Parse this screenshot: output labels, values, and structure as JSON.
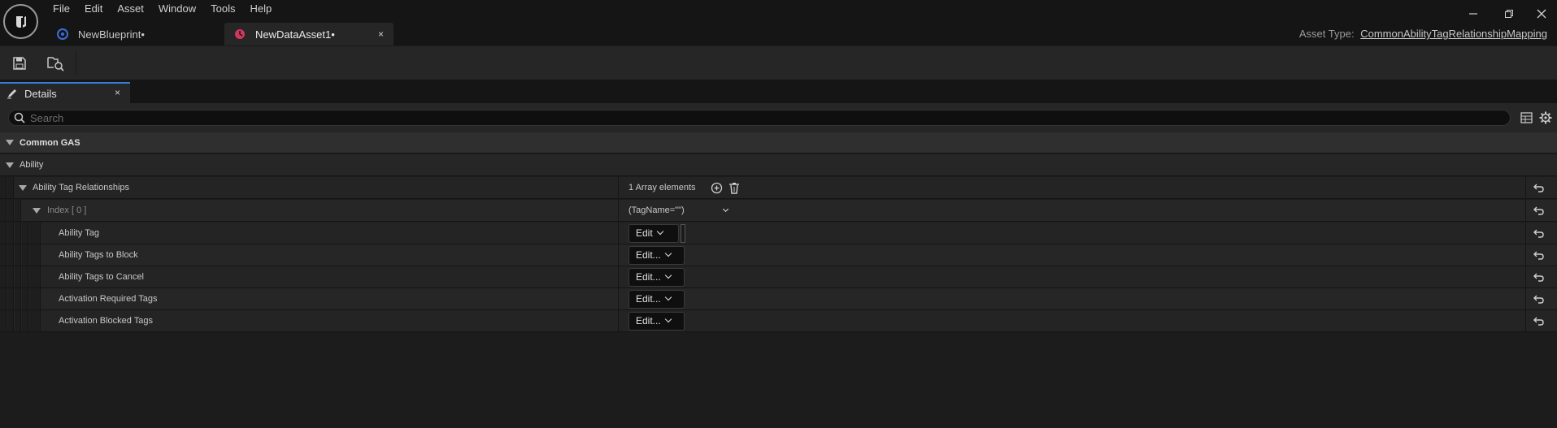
{
  "menu": [
    "File",
    "Edit",
    "Asset",
    "Window",
    "Tools",
    "Help"
  ],
  "tabs": [
    {
      "label": "NewBlueprint•",
      "icon": "blueprint-icon"
    },
    {
      "label": "NewDataAsset1•",
      "icon": "data-asset-icon",
      "close": "×"
    }
  ],
  "asset_type": {
    "label": "Asset Type:",
    "value": "CommonAbilityTagRelationshipMapping"
  },
  "toolbar": {
    "save": "save-icon",
    "browse": "browse-to-asset-icon"
  },
  "details": {
    "tab_label": "Details",
    "close": "×",
    "search_placeholder": "Search",
    "category_main": "Common GAS",
    "category_sub": "Ability",
    "array": {
      "label": "Ability Tag Relationships",
      "count": "1 Array elements"
    },
    "index": {
      "label": "Index [ 0 ]",
      "value": "(TagName=\"\")"
    },
    "properties": [
      {
        "label": "Ability Tag",
        "button": "Edit"
      },
      {
        "label": "Ability Tags to Block",
        "button": "Edit..."
      },
      {
        "label": "Ability Tags to Cancel",
        "button": "Edit..."
      },
      {
        "label": "Activation Required Tags",
        "button": "Edit..."
      },
      {
        "label": "Activation Blocked Tags",
        "button": "Edit..."
      }
    ]
  },
  "colors": {
    "accent": "#3a7bd5",
    "data_asset": "#d1375a",
    "blueprint": "#3b6fd6"
  }
}
